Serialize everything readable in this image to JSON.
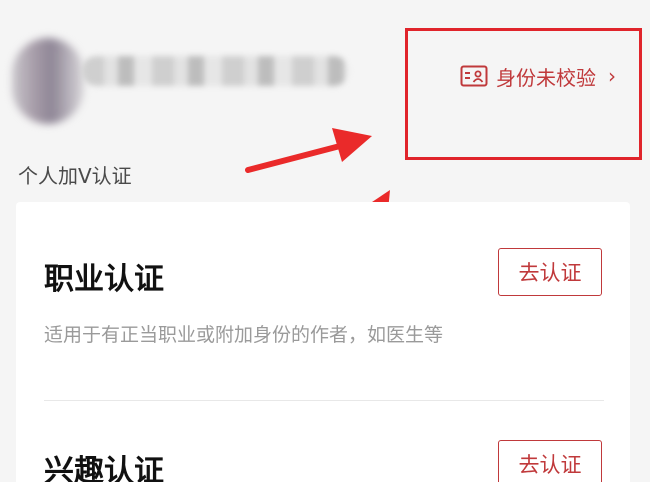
{
  "profile": {
    "id_status_label": "身份未校验",
    "chevron": "›",
    "icon": "id-card-icon"
  },
  "section": {
    "label": "个人加V认证"
  },
  "cards": [
    {
      "title": "职业认证",
      "description": "适用于有正当职业或附加身份的作者，如医生等",
      "button": "去认证"
    },
    {
      "title": "兴趣认证",
      "button": "去认证"
    }
  ],
  "colors": {
    "accent": "#c0393b",
    "highlight": "#e0242b",
    "background": "#f5f5f5"
  }
}
